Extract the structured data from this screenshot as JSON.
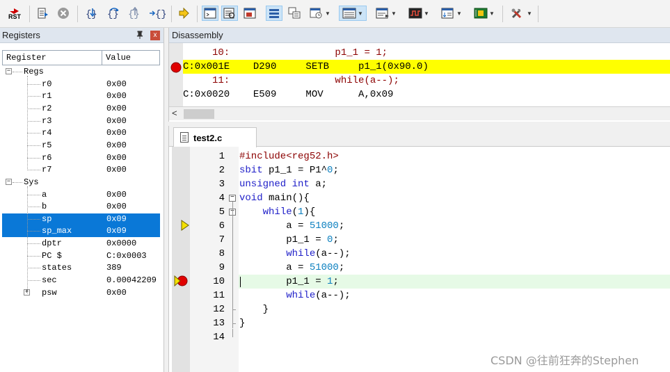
{
  "toolbar": {
    "reset_label": "RST",
    "items": [
      "reset-cpu",
      "run",
      "stop",
      "step-into",
      "step-over",
      "step-out",
      "run-to-cursor",
      "show-next-statement",
      "command-window",
      "disassembly-window",
      "symbols-window",
      "registers-window",
      "call-stack-window",
      "watch-window",
      "memory-window",
      "serial-window",
      "analysis-window",
      "trace-window",
      "system-viewer",
      "toolbox"
    ]
  },
  "registers": {
    "title": "Registers",
    "pin_glyph": "ꟷ",
    "close_glyph": "x",
    "col_register": "Register",
    "col_value": "Value",
    "rows": [
      {
        "name": "Regs",
        "value": ""
      },
      {
        "name": "r0",
        "value": "0x00"
      },
      {
        "name": "r1",
        "value": "0x00"
      },
      {
        "name": "r2",
        "value": "0x00"
      },
      {
        "name": "r3",
        "value": "0x00"
      },
      {
        "name": "r4",
        "value": "0x00"
      },
      {
        "name": "r5",
        "value": "0x00"
      },
      {
        "name": "r6",
        "value": "0x00"
      },
      {
        "name": "r7",
        "value": "0x00"
      },
      {
        "name": "Sys",
        "value": ""
      },
      {
        "name": "a",
        "value": "0x00"
      },
      {
        "name": "b",
        "value": "0x00"
      },
      {
        "name": "sp",
        "value": "0x09"
      },
      {
        "name": "sp_max",
        "value": "0x09"
      },
      {
        "name": "dptr",
        "value": "0x0000"
      },
      {
        "name": "PC  $",
        "value": "C:0x0003"
      },
      {
        "name": "states",
        "value": "389"
      },
      {
        "name": "sec",
        "value": "0.00042209"
      },
      {
        "name": "psw",
        "value": "0x00"
      }
    ],
    "expander_open": "−",
    "expander_closed": "+"
  },
  "disassembly": {
    "title": "Disassembly",
    "lines": [
      {
        "text": "     10:                  p1_1 = 1;",
        "kind": "src"
      },
      {
        "text": "C:0x001E    D290     SETB     p1_1(0x90.0)",
        "kind": "asm"
      },
      {
        "text": "     11:                  while(a--);",
        "kind": "src"
      },
      {
        "text": "C:0x0020    E509     MOV      A,0x09",
        "kind": "asm"
      }
    ],
    "scroll_left": "<"
  },
  "editor": {
    "tab_label": "test2.c",
    "lines": [
      {
        "n": "1",
        "code": "#include<reg52.h>"
      },
      {
        "n": "2",
        "code": "sbit p1_1 = P1^0;"
      },
      {
        "n": "3",
        "code": "unsigned int a;"
      },
      {
        "n": "4",
        "code": "void main(){"
      },
      {
        "n": "5",
        "code": "    while(1){"
      },
      {
        "n": "6",
        "code": "        a = 51000;"
      },
      {
        "n": "7",
        "code": "        p1_1 = 0;"
      },
      {
        "n": "8",
        "code": "        while(a--);"
      },
      {
        "n": "9",
        "code": "        a = 51000;"
      },
      {
        "n": "10",
        "code": "        p1_1 = 1;"
      },
      {
        "n": "11",
        "code": "        while(a--);"
      },
      {
        "n": "12",
        "code": "    }"
      },
      {
        "n": "13",
        "code": "}"
      },
      {
        "n": "14",
        "code": ""
      }
    ],
    "fold_minus": "−"
  },
  "watermark": "CSDN @往前狂奔的Stephen",
  "colors": {
    "current_line": "#ffff00",
    "selection": "#0a78d7",
    "breakpoint": "#e00000",
    "keyword": "#1e1ec8",
    "preprocessor": "#8b0000",
    "number": "#0a7fbf"
  }
}
